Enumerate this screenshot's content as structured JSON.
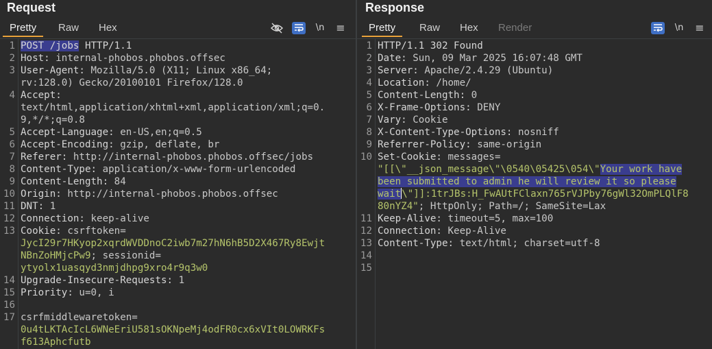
{
  "request": {
    "title": "Request",
    "tabs": [
      "Pretty",
      "Raw",
      "Hex"
    ],
    "tools": {
      "hide": "eye-off-icon",
      "wrap": "wrap-icon",
      "newline": "\\n",
      "menu": "≡"
    },
    "gutter": [
      "1",
      "2",
      "3",
      "",
      "4",
      "",
      "",
      "5",
      "6",
      "7",
      "8",
      "9",
      "10",
      "11",
      "12",
      "13",
      "",
      "",
      "",
      "14",
      "15",
      "16",
      "17",
      "",
      ""
    ],
    "lines": {
      "l1a": "POST /jobs",
      "l1b": " HTTP/1.1",
      "l2k": "Host:",
      "l2v": " internal-phobos.phobos.offsec",
      "l3k": "User-Agent:",
      "l3v": " Mozilla/5.0 (X11; Linux x86_64;",
      "l3c": "rv:128.0) Gecko/20100101 Firefox/128.0",
      "l4k": "Accept:",
      "l4c1": "text/html,application/xhtml+xml,application/xml;q=0.",
      "l4c2": "9,*/*;q=0.8",
      "l5k": "Accept-Language:",
      "l5v": " en-US,en;q=0.5",
      "l6k": "Accept-Encoding:",
      "l6v": " gzip, deflate, br",
      "l7k": "Referer:",
      "l7v": " http://internal-phobos.phobos.offsec/jobs",
      "l8k": "Content-Type:",
      "l8v": " application/x-www-form-urlencoded",
      "l9k": "Content-Length:",
      "l9v": " 84",
      "l10k": "Origin:",
      "l10v": " http://internal-phobos.phobos.offsec",
      "l11k": "DNT:",
      "l11v": " 1",
      "l12k": "Connection:",
      "l12v": " keep-alive",
      "l13k": "Cookie:",
      "l13n1": " csrftoken",
      "l13c1": "JycI29r7HKyop2xqrdWVDDnoC2iwb7m27hN6hB5D2X467Ry8Ewjt",
      "l13c2": "NBnZoHMjcPw9",
      "l13sep": "; ",
      "l13n2": "sessionid",
      "l13c3": "ytyolx1uasqyd3nmjdhpg9xro4r9q3w0",
      "l14k": "Upgrade-Insecure-Requests:",
      "l14v": " 1",
      "l15k": "Priority:",
      "l15v": " u=0, i",
      "l17k": "csrfmiddlewaretoken",
      "l17c1": "0u4tLKTAcIcL6WNeEriU581sOKNpeMj4odFR0cx6xVIt0LOWRKFs",
      "l17c2": "f613Aphcfutb"
    }
  },
  "response": {
    "title": "Response",
    "tabs": [
      "Pretty",
      "Raw",
      "Hex",
      "Render"
    ],
    "tools": {
      "wrap": "wrap-icon",
      "newline": "\\n",
      "menu": "≡"
    },
    "gutter": [
      "1",
      "2",
      "3",
      "4",
      "5",
      "6",
      "7",
      "8",
      "9",
      "10",
      "",
      "",
      "",
      "",
      "11",
      "12",
      "13",
      "14",
      "15"
    ],
    "lines": {
      "r1": "HTTP/1.1 302 Found",
      "r2k": "Date:",
      "r2v": " Sun, 09 Mar 2025 16:07:48 GMT",
      "r3k": "Server:",
      "r3v": " Apache/2.4.29 (Ubuntu)",
      "r4k": "Location:",
      "r4v": " /home/",
      "r5k": "Content-Length:",
      "r5v": " 0",
      "r6k": "X-Frame-Options:",
      "r6v": " DENY",
      "r7k": "Vary:",
      "r7v": " Cookie",
      "r8k": "X-Content-Type-Options:",
      "r8v": " nosniff",
      "r9k": "Referrer-Policy:",
      "r9v": " same-origin",
      "r10k": "Set-Cookie:",
      "r10v": " messages=",
      "r10a": "\"[[\\\"__json_message\\\"\\0540\\05425\\054\\\"",
      "r10s1": "Your work have",
      "r10s2": "been submitted to admin he will review it so please",
      "r10s3": "wait",
      "r10b": "\\\"]]:1trJBs:H_FwAUtFClaxn765rVJPby76gWl32OmPLQlF8",
      "r10c": "80nYZ4\"",
      "r10d": "; HttpOnly; Path=/; SameSite=Lax",
      "r11k": "Keep-Alive:",
      "r11v": " timeout=5, max=100",
      "r12k": "Connection:",
      "r12v": " Keep-Alive",
      "r13k": "Content-Type:",
      "r13v": " text/html; charset=utf-8"
    }
  },
  "colors": {
    "accent_tab": "#e8a23a",
    "accent_button": "#3f6fc4",
    "cookie_value": "#b5c46b",
    "selection": "#3a3d8f"
  }
}
